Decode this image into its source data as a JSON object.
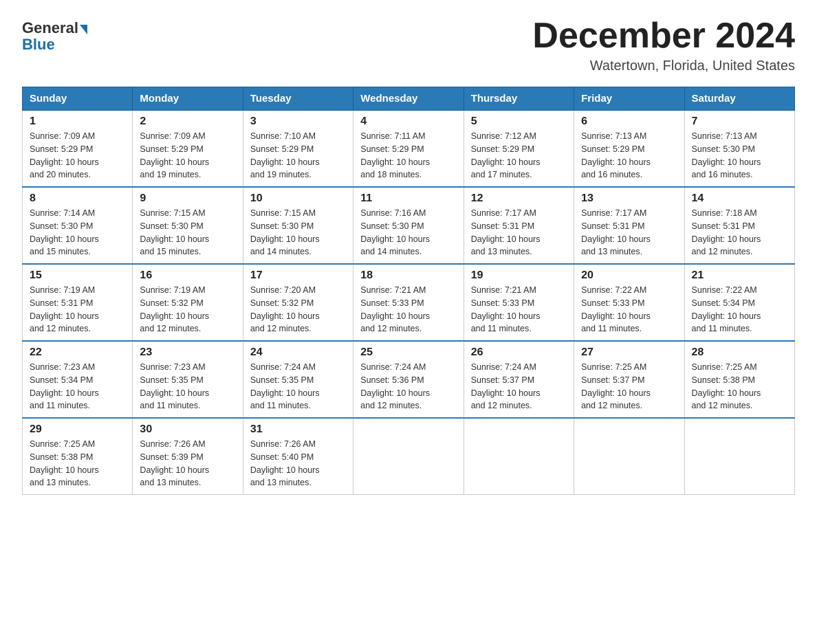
{
  "header": {
    "logo_general": "General",
    "logo_blue": "Blue",
    "title": "December 2024",
    "subtitle": "Watertown, Florida, United States"
  },
  "weekdays": [
    "Sunday",
    "Monday",
    "Tuesday",
    "Wednesday",
    "Thursday",
    "Friday",
    "Saturday"
  ],
  "weeks": [
    [
      {
        "day": "1",
        "sunrise": "7:09 AM",
        "sunset": "5:29 PM",
        "daylight": "10 hours and 20 minutes."
      },
      {
        "day": "2",
        "sunrise": "7:09 AM",
        "sunset": "5:29 PM",
        "daylight": "10 hours and 19 minutes."
      },
      {
        "day": "3",
        "sunrise": "7:10 AM",
        "sunset": "5:29 PM",
        "daylight": "10 hours and 19 minutes."
      },
      {
        "day": "4",
        "sunrise": "7:11 AM",
        "sunset": "5:29 PM",
        "daylight": "10 hours and 18 minutes."
      },
      {
        "day": "5",
        "sunrise": "7:12 AM",
        "sunset": "5:29 PM",
        "daylight": "10 hours and 17 minutes."
      },
      {
        "day": "6",
        "sunrise": "7:13 AM",
        "sunset": "5:29 PM",
        "daylight": "10 hours and 16 minutes."
      },
      {
        "day": "7",
        "sunrise": "7:13 AM",
        "sunset": "5:30 PM",
        "daylight": "10 hours and 16 minutes."
      }
    ],
    [
      {
        "day": "8",
        "sunrise": "7:14 AM",
        "sunset": "5:30 PM",
        "daylight": "10 hours and 15 minutes."
      },
      {
        "day": "9",
        "sunrise": "7:15 AM",
        "sunset": "5:30 PM",
        "daylight": "10 hours and 15 minutes."
      },
      {
        "day": "10",
        "sunrise": "7:15 AM",
        "sunset": "5:30 PM",
        "daylight": "10 hours and 14 minutes."
      },
      {
        "day": "11",
        "sunrise": "7:16 AM",
        "sunset": "5:30 PM",
        "daylight": "10 hours and 14 minutes."
      },
      {
        "day": "12",
        "sunrise": "7:17 AM",
        "sunset": "5:31 PM",
        "daylight": "10 hours and 13 minutes."
      },
      {
        "day": "13",
        "sunrise": "7:17 AM",
        "sunset": "5:31 PM",
        "daylight": "10 hours and 13 minutes."
      },
      {
        "day": "14",
        "sunrise": "7:18 AM",
        "sunset": "5:31 PM",
        "daylight": "10 hours and 12 minutes."
      }
    ],
    [
      {
        "day": "15",
        "sunrise": "7:19 AM",
        "sunset": "5:31 PM",
        "daylight": "10 hours and 12 minutes."
      },
      {
        "day": "16",
        "sunrise": "7:19 AM",
        "sunset": "5:32 PM",
        "daylight": "10 hours and 12 minutes."
      },
      {
        "day": "17",
        "sunrise": "7:20 AM",
        "sunset": "5:32 PM",
        "daylight": "10 hours and 12 minutes."
      },
      {
        "day": "18",
        "sunrise": "7:21 AM",
        "sunset": "5:33 PM",
        "daylight": "10 hours and 12 minutes."
      },
      {
        "day": "19",
        "sunrise": "7:21 AM",
        "sunset": "5:33 PM",
        "daylight": "10 hours and 11 minutes."
      },
      {
        "day": "20",
        "sunrise": "7:22 AM",
        "sunset": "5:33 PM",
        "daylight": "10 hours and 11 minutes."
      },
      {
        "day": "21",
        "sunrise": "7:22 AM",
        "sunset": "5:34 PM",
        "daylight": "10 hours and 11 minutes."
      }
    ],
    [
      {
        "day": "22",
        "sunrise": "7:23 AM",
        "sunset": "5:34 PM",
        "daylight": "10 hours and 11 minutes."
      },
      {
        "day": "23",
        "sunrise": "7:23 AM",
        "sunset": "5:35 PM",
        "daylight": "10 hours and 11 minutes."
      },
      {
        "day": "24",
        "sunrise": "7:24 AM",
        "sunset": "5:35 PM",
        "daylight": "10 hours and 11 minutes."
      },
      {
        "day": "25",
        "sunrise": "7:24 AM",
        "sunset": "5:36 PM",
        "daylight": "10 hours and 12 minutes."
      },
      {
        "day": "26",
        "sunrise": "7:24 AM",
        "sunset": "5:37 PM",
        "daylight": "10 hours and 12 minutes."
      },
      {
        "day": "27",
        "sunrise": "7:25 AM",
        "sunset": "5:37 PM",
        "daylight": "10 hours and 12 minutes."
      },
      {
        "day": "28",
        "sunrise": "7:25 AM",
        "sunset": "5:38 PM",
        "daylight": "10 hours and 12 minutes."
      }
    ],
    [
      {
        "day": "29",
        "sunrise": "7:25 AM",
        "sunset": "5:38 PM",
        "daylight": "10 hours and 13 minutes."
      },
      {
        "day": "30",
        "sunrise": "7:26 AM",
        "sunset": "5:39 PM",
        "daylight": "10 hours and 13 minutes."
      },
      {
        "day": "31",
        "sunrise": "7:26 AM",
        "sunset": "5:40 PM",
        "daylight": "10 hours and 13 minutes."
      },
      null,
      null,
      null,
      null
    ]
  ],
  "labels": {
    "sunrise": "Sunrise:",
    "sunset": "Sunset:",
    "daylight": "Daylight:"
  }
}
